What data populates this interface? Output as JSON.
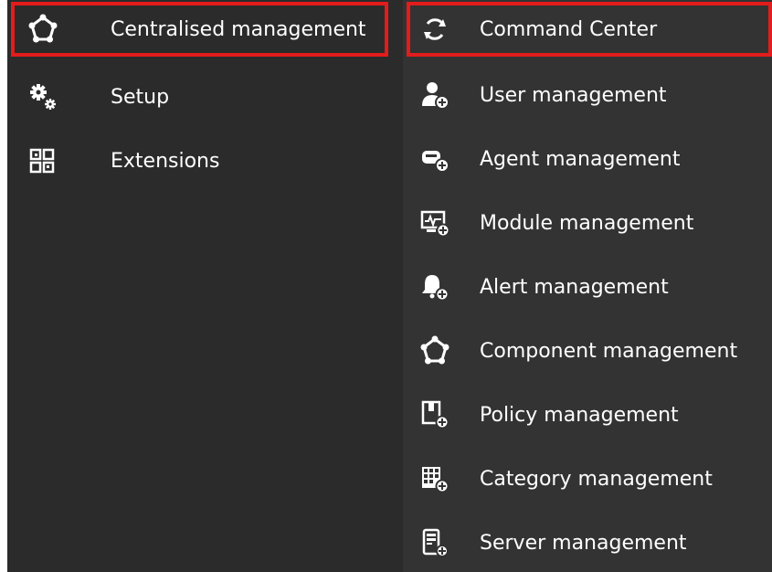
{
  "colors": {
    "background": "#2b2b2b",
    "submenu_background": "#333333",
    "text": "#ffffff",
    "highlight_border": "#e31c1c"
  },
  "main_menu": {
    "items": [
      {
        "label": "Centralised management",
        "icon": "network-pentagon-icon",
        "selected": true
      },
      {
        "label": "Setup",
        "icon": "gears-icon",
        "selected": false
      },
      {
        "label": "Extensions",
        "icon": "extensions-grid-icon",
        "selected": false
      }
    ]
  },
  "submenu": {
    "items": [
      {
        "label": "Command Center",
        "icon": "refresh-cycle-icon",
        "selected": true
      },
      {
        "label": "User management",
        "icon": "user-add-icon",
        "selected": false
      },
      {
        "label": "Agent management",
        "icon": "agent-add-icon",
        "selected": false
      },
      {
        "label": "Module management",
        "icon": "monitor-pulse-add-icon",
        "selected": false
      },
      {
        "label": "Alert management",
        "icon": "bell-add-icon",
        "selected": false
      },
      {
        "label": "Component management",
        "icon": "network-pentagon-icon",
        "selected": false
      },
      {
        "label": "Policy management",
        "icon": "policy-add-icon",
        "selected": false
      },
      {
        "label": "Category management",
        "icon": "category-grid-add-icon",
        "selected": false
      },
      {
        "label": "Server management",
        "icon": "server-add-icon",
        "selected": false
      }
    ]
  }
}
